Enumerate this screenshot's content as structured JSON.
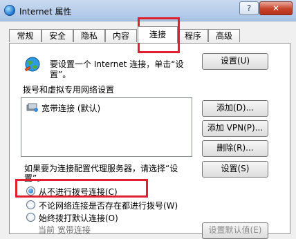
{
  "window": {
    "title": "Internet 属性",
    "help_label": "?",
    "close_label": "✕"
  },
  "tabs": [
    {
      "label": "常规"
    },
    {
      "label": "安全"
    },
    {
      "label": "隐私"
    },
    {
      "label": "内容"
    },
    {
      "label": "连接",
      "active": true
    },
    {
      "label": "程序"
    },
    {
      "label": "高级"
    }
  ],
  "connections": {
    "setup_text_line1": "要设置一个 Internet 连接，单击“设",
    "setup_text_line2": "置”。",
    "setup_button": "设置(U)",
    "dialup_section_label": "拨号和虚拟专用网络设置",
    "list_items": [
      {
        "label": "宽带连接 (默认)"
      }
    ],
    "add_button": "添加(D)...",
    "add_vpn_button": "添加 VPN(P)...",
    "remove_button": "删除(R)...",
    "proxy_text_line1": "如果要为连接配置代理服务器，请选择“设",
    "proxy_text_line2": "置”。",
    "settings_button": "设置(S)",
    "radio_options": [
      {
        "label": "从不进行拨号连接(C)",
        "checked": true
      },
      {
        "label": "不论网络连接是否存在都进行拨号(W)",
        "checked": false
      },
      {
        "label": "始终拨打默认连接(O)",
        "checked": false
      }
    ],
    "current_label": "当前 宽带连接",
    "set_default_button": "设置默认值(E)"
  },
  "colors": {
    "highlight": "#e0202e",
    "titlebar": "#b7cdea"
  },
  "icons": {
    "title": "internet-globe-icon",
    "setup": "globe-connection-icon",
    "connection": "dialup-connection-icon"
  }
}
